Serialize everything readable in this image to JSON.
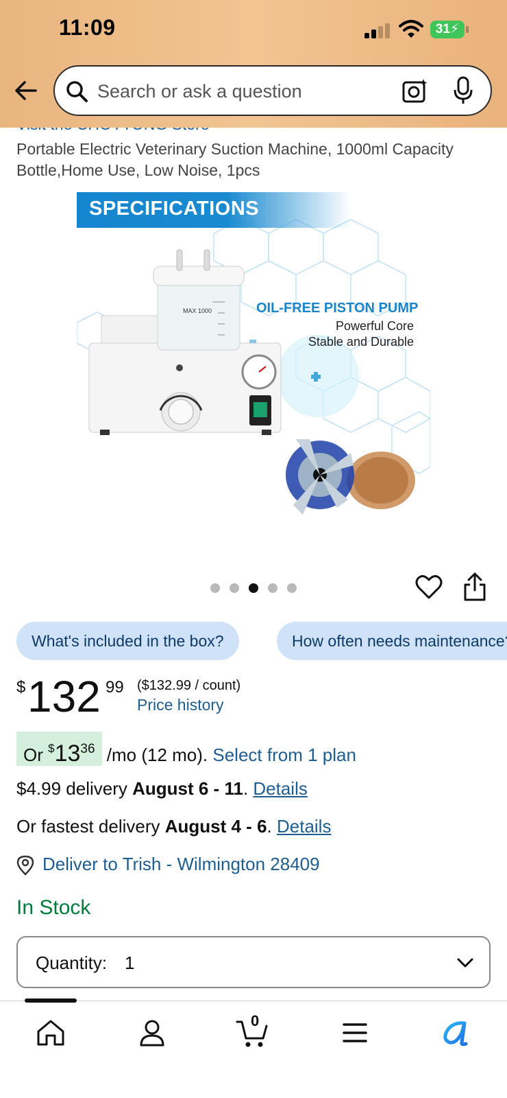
{
  "status_bar": {
    "time": "11:09",
    "battery": "31"
  },
  "search": {
    "placeholder": "Search or ask a question"
  },
  "product": {
    "store_link": "Visit the CHOYTONG Store",
    "title": "Portable Electric Veterinary Suction Machine, 1000ml Capacity Bottle,Home Use, Low Noise, 1pcs",
    "image": {
      "banner": "SPECIFICATIONS",
      "headline": "OIL-FREE PISTON PUMP",
      "line1": "Powerful Core",
      "line2": "Stable and Durable",
      "gauge_label": "MAX  1000"
    },
    "carousel": {
      "count": 5,
      "active_index": 2
    }
  },
  "chips": [
    {
      "label": "What's included in the box?"
    },
    {
      "label": "How often needs maintenance?"
    }
  ],
  "price": {
    "symbol": "$",
    "whole": "132",
    "cents": "99",
    "per_unit": "($132.99 / count)",
    "history_link": "Price history"
  },
  "plan": {
    "prefix": "Or ",
    "symbol": "$",
    "whole": "13",
    "cents": "36",
    "suffix": " /mo (12 mo). ",
    "link": "Select from 1 plan"
  },
  "delivery": {
    "standard_prefix": "$4.99 delivery ",
    "standard_dates": "August 6 - 11",
    "fastest_prefix": "Or fastest delivery ",
    "fastest_dates": "August 4 - 6",
    "details_link": "Details",
    "sep": ". ",
    "deliver_to": "Deliver to Trish - Wilmington 28409"
  },
  "stock": {
    "status": "In Stock"
  },
  "quantity": {
    "label": "Quantity:",
    "value": "1"
  },
  "nav": {
    "items": [
      "home-icon",
      "account-icon",
      "cart-icon",
      "menu-icon",
      "rufus-icon"
    ],
    "cart_count": "0"
  },
  "colors": {
    "header_bg": "#efbd89",
    "link": "#1f5d8f",
    "in_stock": "#007a3d",
    "plan_badge": "#d4f0dd",
    "chip_bg": "#cfe2f8",
    "battery": "#3fc55a"
  }
}
